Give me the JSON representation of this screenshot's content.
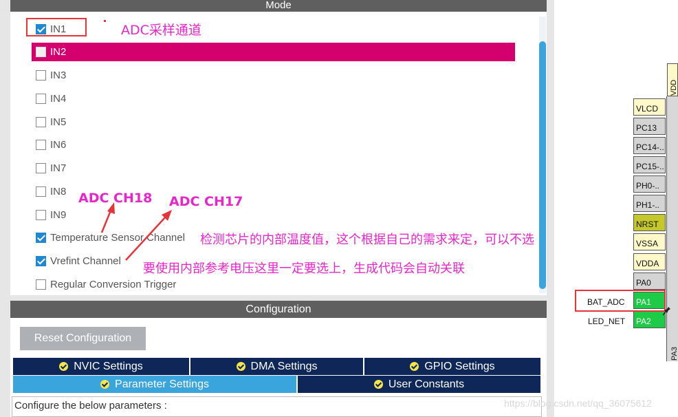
{
  "mode": {
    "header": "Mode",
    "channels": [
      {
        "label": "IN1",
        "checked": true
      },
      {
        "label": "IN2",
        "checked": false,
        "highlighted": true
      },
      {
        "label": "IN3",
        "checked": false
      },
      {
        "label": "IN4",
        "checked": false
      },
      {
        "label": "IN5",
        "checked": false
      },
      {
        "label": "IN6",
        "checked": false
      },
      {
        "label": "IN7",
        "checked": false
      },
      {
        "label": "IN8",
        "checked": false
      },
      {
        "label": "IN9",
        "checked": false
      },
      {
        "label": "Temperature Sensor Channel",
        "checked": true
      },
      {
        "label": "Vrefint Channel",
        "checked": true
      },
      {
        "label": "Regular Conversion Trigger",
        "checked": false
      }
    ]
  },
  "annotations": {
    "adc_sampling": "ADC采样通道",
    "ch18": "ADC CH18",
    "ch17": "ADC CH17",
    "temp_note": "检测芯片的内部温度值，这个根据自己的需求来定，可以不选",
    "vref_note": "要使用内部参考电压这里一定要选上，生成代码会自动关联"
  },
  "configuration": {
    "header": "Configuration",
    "reset_button": "Reset Configuration",
    "tabs": [
      {
        "label": "NVIC Settings",
        "active": false
      },
      {
        "label": "DMA Settings",
        "active": false
      },
      {
        "label": "GPIO Settings",
        "active": false
      },
      {
        "label": "Parameter Settings",
        "active": true
      },
      {
        "label": "User Constants",
        "active": false
      }
    ],
    "description": "Configure the below parameters :"
  },
  "pinout": {
    "pins": [
      {
        "label": "VLCD",
        "color": "cream"
      },
      {
        "label": "PC13",
        "color": "gray"
      },
      {
        "label": "PC14-..",
        "color": "gray"
      },
      {
        "label": "PC15-..",
        "color": "gray"
      },
      {
        "label": "PH0-..",
        "color": "gray"
      },
      {
        "label": "PH1-..",
        "color": "gray"
      },
      {
        "label": "NRST",
        "color": "olive"
      },
      {
        "label": "VSSA",
        "color": "cream"
      },
      {
        "label": "VDDA",
        "color": "cream"
      },
      {
        "label": "PA0",
        "color": "gray"
      },
      {
        "label": "PA1",
        "color": "green"
      },
      {
        "label": "PA2",
        "color": "green"
      }
    ],
    "signal_bat": "BAT_ADC",
    "signal_led": "LED_NET",
    "top_pin_label": "VDD",
    "bottom_pin_label": "PA3"
  },
  "watermark": "https://blog.csdn.net/qq_36075612",
  "colors": {
    "highlight": "#d4006e",
    "annotation": "#e626c8",
    "red_marker": "#e8333a",
    "tab_dark": "#0e2758",
    "tab_active": "#3aa4dc",
    "pin_green": "#1ecb46"
  }
}
